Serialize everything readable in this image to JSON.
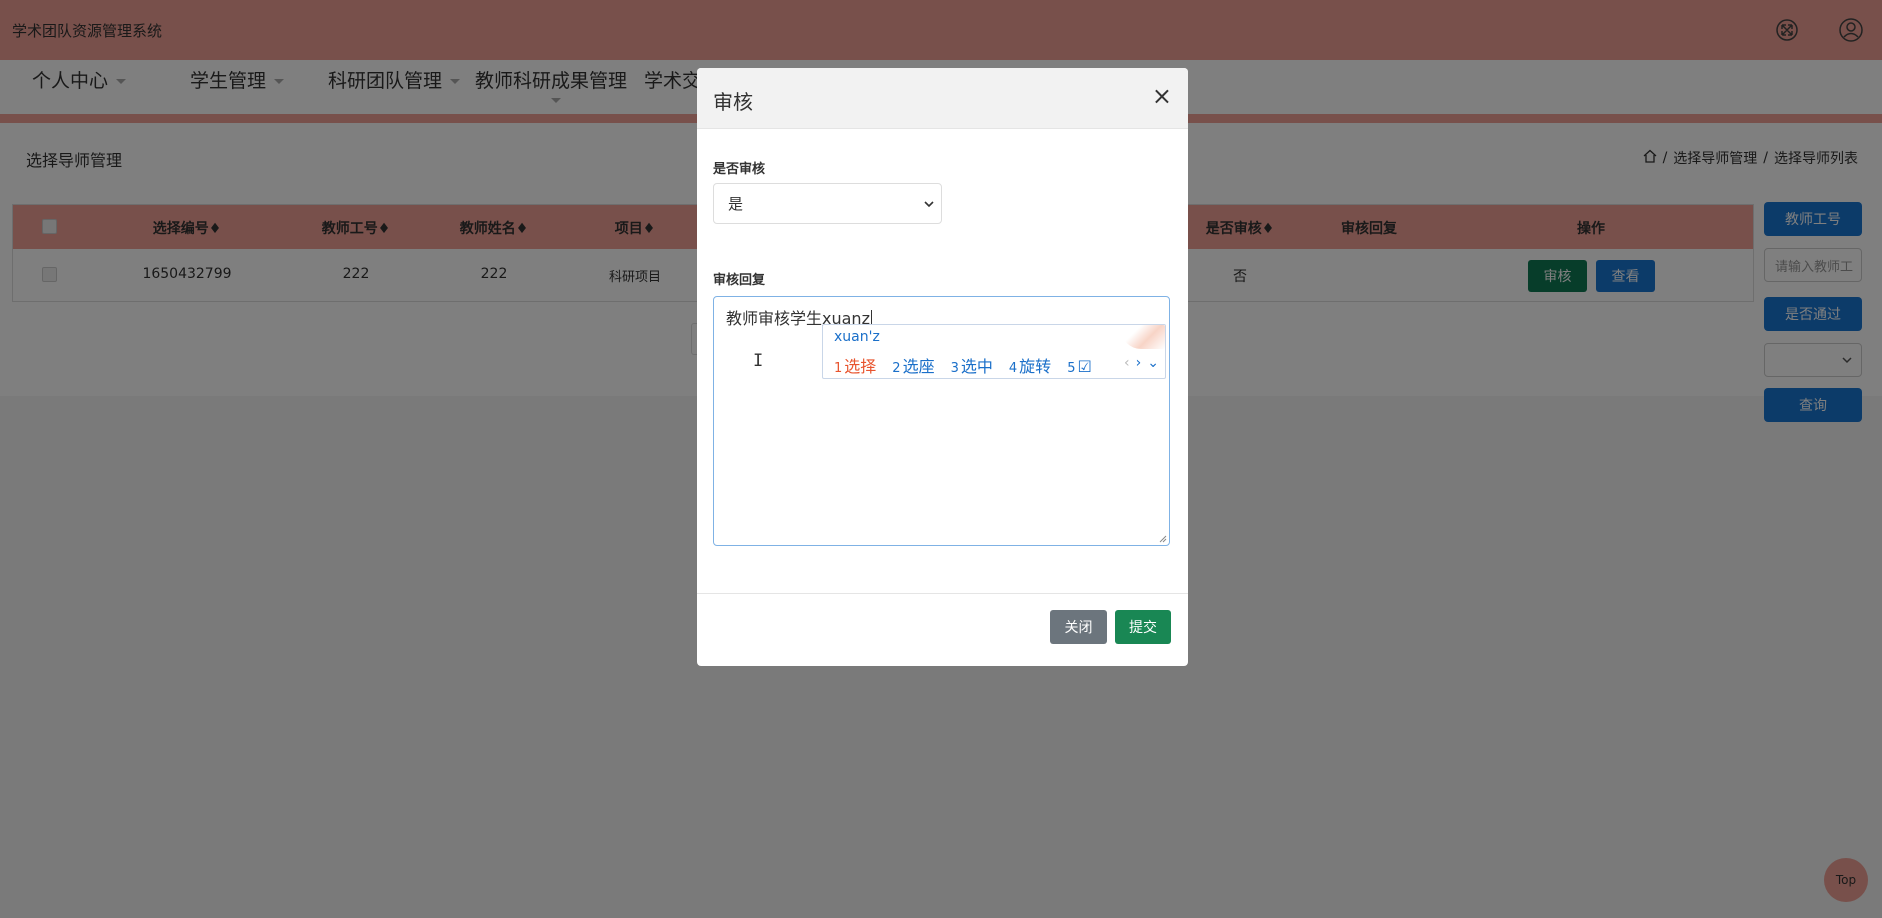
{
  "app": {
    "title": "学术团队资源管理系统"
  },
  "nav": {
    "items": [
      {
        "label": "个人中心"
      },
      {
        "label": "学生管理"
      },
      {
        "label": "科研团队管理"
      },
      {
        "label": "教师科研成果管理"
      },
      {
        "label": "学术交"
      }
    ]
  },
  "page": {
    "heading": "选择导师管理",
    "breadcrumb": [
      "选择导师管理",
      "选择导师列表"
    ],
    "breadcrumb_sep": "/"
  },
  "table": {
    "columns": [
      "选择编号",
      "教师工号",
      "教师姓名",
      "项目",
      "是否审核",
      "审核回复",
      "操作"
    ],
    "sort_mark": "♦",
    "rows": [
      {
        "id": "1650432799",
        "teacher_no": "222",
        "teacher_name": "222",
        "project": "科研项目",
        "reviewed": "否",
        "reply": ""
      }
    ],
    "actions": {
      "review": "审核",
      "view": "查看"
    }
  },
  "side_panel": {
    "teacher_no_button": "教师工号",
    "teacher_no_placeholder": "请输入教师工",
    "passed_button": "是否通过",
    "query_button": "查询"
  },
  "back_to_top": "Top",
  "modal": {
    "title": "审核",
    "close_symbol": "×",
    "review_label": "是否审核",
    "review_value": "是",
    "reply_label": "审核回复",
    "reply_committed": "教师审核学生",
    "reply_composing": "xuanz",
    "close_button": "关闭",
    "submit_button": "提交"
  },
  "ime": {
    "composition": "xuan'z",
    "candidates": [
      {
        "num": "1",
        "text": "选择"
      },
      {
        "num": "2",
        "text": "选座"
      },
      {
        "num": "3",
        "text": "选中"
      },
      {
        "num": "4",
        "text": "旋转"
      },
      {
        "num": "5",
        "text": "☑"
      }
    ],
    "prev": "‹",
    "next": "›",
    "expand": "⌄"
  },
  "colors": {
    "accent_pink": "#f0a196",
    "primary_blue": "#1976d2",
    "success_green": "#198754",
    "review_green": "#0f7a55",
    "secondary_gray": "#6c757d"
  }
}
